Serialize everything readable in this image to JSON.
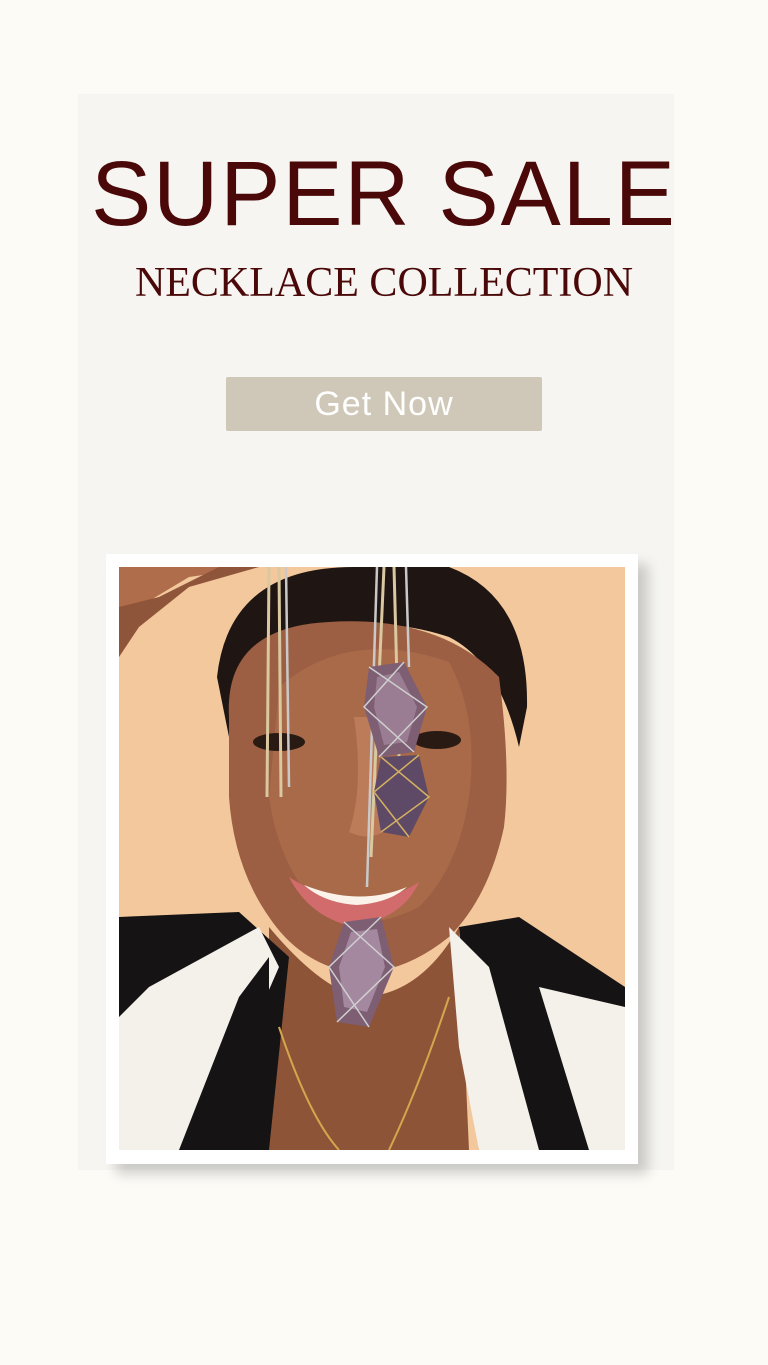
{
  "promo": {
    "headline": "SUPER SALE",
    "subheadline": "NECKLACE COLLECTION",
    "cta_label": "Get Now"
  },
  "colors": {
    "background": "#fdfbf6",
    "card": "#f6f5f1",
    "headline": "#4a0808",
    "cta_background": "#cfc8b8",
    "cta_text": "#ffffff",
    "photo_background": "#f2c496"
  },
  "image": {
    "name": "model-with-amethyst-necklaces-photo"
  }
}
